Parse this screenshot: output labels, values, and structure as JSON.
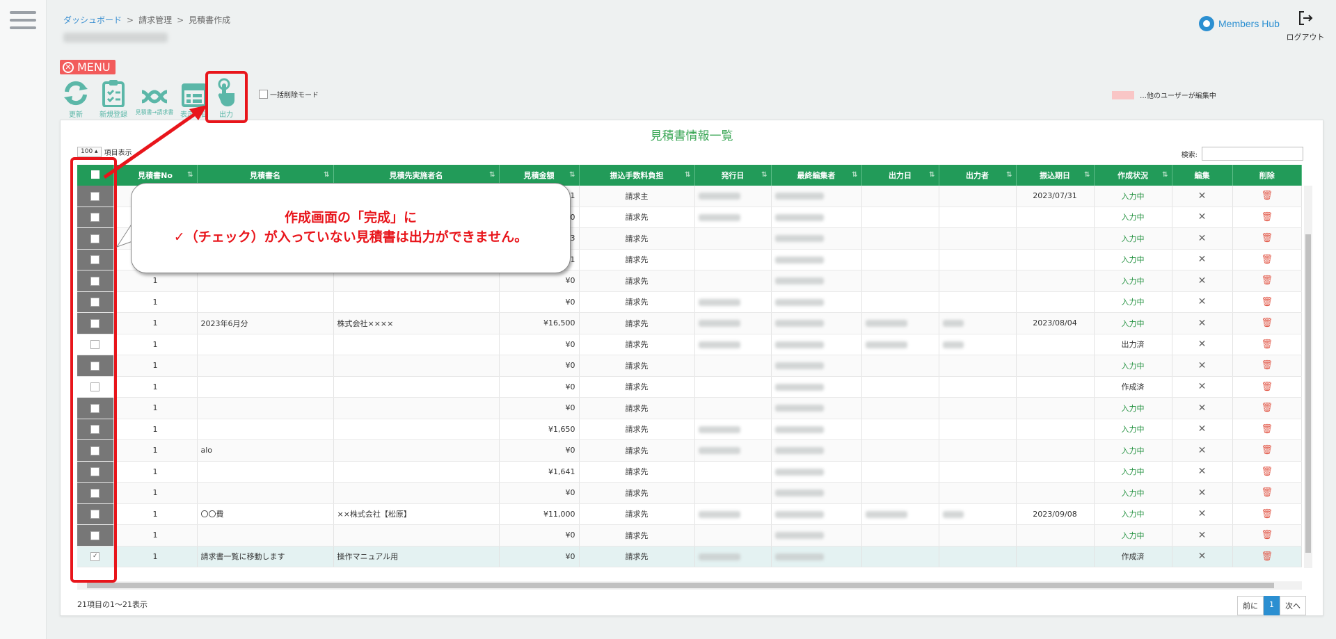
{
  "breadcrumb": {
    "item1": "ダッシュボード",
    "item2": "請求管理",
    "item3": "見積書作成",
    "sep": ">"
  },
  "brand": {
    "name": "Members Hub"
  },
  "logout": {
    "label": "ログアウト"
  },
  "menu": {
    "label": "MENU"
  },
  "toolbar": {
    "refresh": "更新",
    "new": "新規登録",
    "convert": "見積書→請求書",
    "hidden": "表示項目",
    "output": "出力"
  },
  "bulk_delete": {
    "label": "一括削除モード"
  },
  "legend": {
    "label": "…他のユーザーが編集中",
    "color": "#f9c6c6"
  },
  "panel": {
    "title": "見積書情報一覧",
    "length_value": "100",
    "length_label": "項目表示",
    "search_label": "検索:"
  },
  "table": {
    "headers": [
      "見積書No",
      "見積書名",
      "見積先実施者名",
      "見積金額",
      "振込手数料負担",
      "発行日",
      "最終編集者",
      "出力日",
      "出力者",
      "振込期日",
      "作成状況",
      "編集",
      "削除"
    ],
    "rows": [
      {
        "no": "",
        "name": "",
        "client": "",
        "amount": "1",
        "fee": "請求主",
        "issued": true,
        "editor": true,
        "outdate": false,
        "outby": false,
        "due": "2023/07/31",
        "status": "入力中",
        "checkbox": "gray"
      },
      {
        "no": "",
        "name": "",
        "client": "",
        "amount": "0",
        "fee": "請求先",
        "issued": true,
        "editor": true,
        "outdate": false,
        "outby": false,
        "due": "",
        "status": "入力中",
        "checkbox": "gray"
      },
      {
        "no": "",
        "name": "",
        "client": "",
        "amount": "3",
        "fee": "請求先",
        "issued": false,
        "editor": true,
        "outdate": false,
        "outby": false,
        "due": "",
        "status": "入力中",
        "checkbox": "gray"
      },
      {
        "no": "",
        "name": "",
        "client": "",
        "amount": "1",
        "fee": "請求先",
        "issued": false,
        "editor": true,
        "outdate": false,
        "outby": false,
        "due": "",
        "status": "入力中",
        "checkbox": "gray"
      },
      {
        "no": "1",
        "name": "",
        "client": "",
        "amount": "¥0",
        "fee": "請求先",
        "issued": false,
        "editor": true,
        "outdate": false,
        "outby": false,
        "due": "",
        "status": "入力中",
        "checkbox": "gray"
      },
      {
        "no": "1",
        "name": "",
        "client": "",
        "amount": "¥0",
        "fee": "請求先",
        "issued": true,
        "editor": true,
        "outdate": false,
        "outby": false,
        "due": "",
        "status": "入力中",
        "checkbox": "gray"
      },
      {
        "no": "1",
        "name": "2023年6月分",
        "client": "株式会社××××",
        "amount": "¥16,500",
        "fee": "請求先",
        "issued": true,
        "editor": true,
        "outdate": true,
        "outby": true,
        "due": "2023/08/04",
        "status": "入力中",
        "checkbox": "gray"
      },
      {
        "no": "1",
        "name": "",
        "client": "",
        "amount": "¥0",
        "fee": "請求先",
        "issued": true,
        "editor": true,
        "outdate": true,
        "outby": true,
        "due": "",
        "status": "出力済",
        "checkbox": "white"
      },
      {
        "no": "1",
        "name": "",
        "client": "",
        "amount": "¥0",
        "fee": "請求先",
        "issued": false,
        "editor": true,
        "outdate": false,
        "outby": false,
        "due": "",
        "status": "入力中",
        "checkbox": "gray"
      },
      {
        "no": "1",
        "name": "",
        "client": "",
        "amount": "¥0",
        "fee": "請求先",
        "issued": false,
        "editor": true,
        "outdate": false,
        "outby": false,
        "due": "",
        "status": "作成済",
        "checkbox": "white"
      },
      {
        "no": "1",
        "name": "",
        "client": "",
        "amount": "¥0",
        "fee": "請求先",
        "issued": false,
        "editor": true,
        "outdate": false,
        "outby": false,
        "due": "",
        "status": "入力中",
        "checkbox": "gray"
      },
      {
        "no": "1",
        "name": "",
        "client": "",
        "amount": "¥1,650",
        "fee": "請求先",
        "issued": true,
        "editor": true,
        "outdate": false,
        "outby": false,
        "due": "",
        "status": "入力中",
        "checkbox": "gray"
      },
      {
        "no": "1",
        "name": "alo",
        "client": "",
        "amount": "¥0",
        "fee": "請求先",
        "issued": true,
        "editor": true,
        "outdate": false,
        "outby": false,
        "due": "",
        "status": "入力中",
        "checkbox": "gray"
      },
      {
        "no": "1",
        "name": "",
        "client": "",
        "amount": "¥1,641",
        "fee": "請求先",
        "issued": false,
        "editor": true,
        "outdate": false,
        "outby": false,
        "due": "",
        "status": "入力中",
        "checkbox": "gray"
      },
      {
        "no": "1",
        "name": "",
        "client": "",
        "amount": "¥0",
        "fee": "請求先",
        "issued": false,
        "editor": true,
        "outdate": false,
        "outby": false,
        "due": "",
        "status": "入力中",
        "checkbox": "gray"
      },
      {
        "no": "1",
        "name": "〇〇費",
        "client": "××株式会社【松原】",
        "amount": "¥11,000",
        "fee": "請求先",
        "issued": true,
        "editor": true,
        "outdate": true,
        "outby": true,
        "due": "2023/09/08",
        "status": "入力中",
        "checkbox": "gray"
      },
      {
        "no": "1",
        "name": "",
        "client": "",
        "amount": "¥0",
        "fee": "請求先",
        "issued": false,
        "editor": true,
        "outdate": false,
        "outby": false,
        "due": "",
        "status": "入力中",
        "checkbox": "gray"
      },
      {
        "no": "1",
        "name": "請求書一覧に移動します",
        "client": "操作マニュアル用",
        "amount": "¥0",
        "fee": "請求先",
        "issued": true,
        "editor": true,
        "outdate": false,
        "outby": false,
        "due": "",
        "status": "作成済",
        "checkbox": "checked"
      }
    ]
  },
  "footer": {
    "info": "21項目の1～21表示",
    "prev": "前に",
    "page": "1",
    "next": "次へ"
  },
  "callout": {
    "line1": "作成画面の「完成」に",
    "line2": "✓（チェック）が入っていない見積書は出力ができません。"
  },
  "colors": {
    "header_green": "#229b59",
    "accent": "#5bb7a8",
    "highlight_red": "#e8151b"
  }
}
